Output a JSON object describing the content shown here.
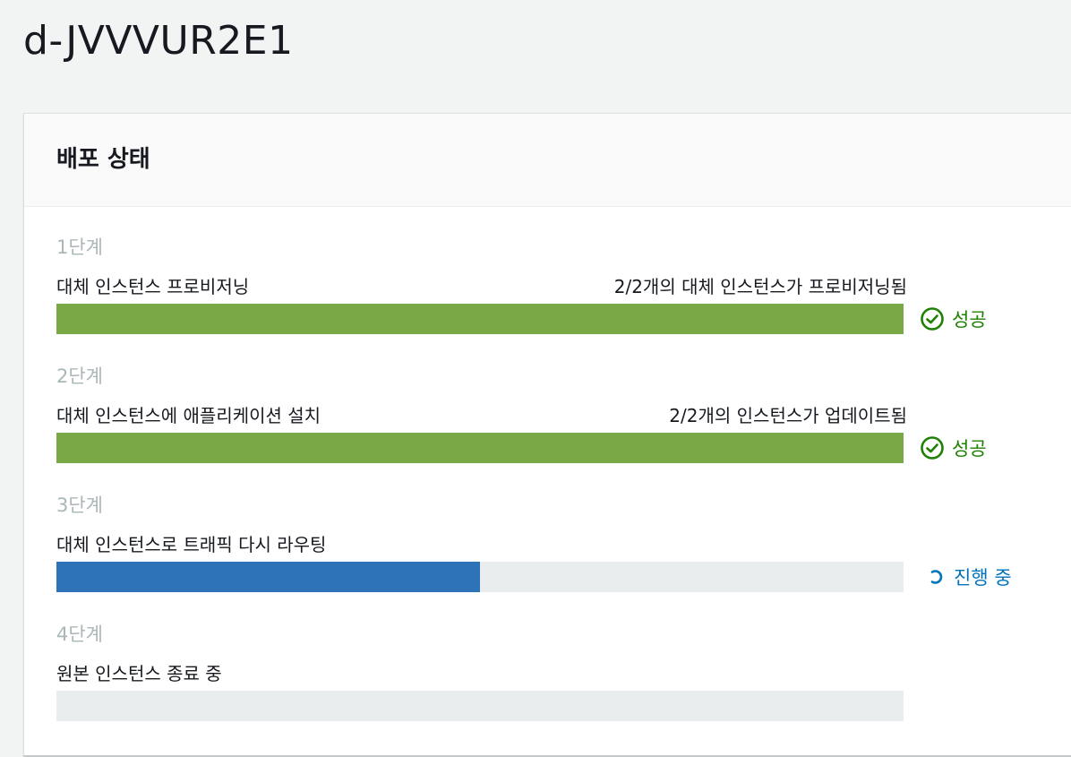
{
  "page": {
    "title": "d-JVVVUR2E1"
  },
  "panel": {
    "title": "배포 상태"
  },
  "colors": {
    "success": "#7aa847",
    "success_text": "#1d8102",
    "in_progress": "#2e73b8",
    "in_progress_text": "#0073bb",
    "track": "#eaeded"
  },
  "steps": [
    {
      "label": "1단계",
      "description": "대체 인스턴스 프로비저닝",
      "count_text": "2/2개의 대체 인스턴스가 프로비저닝됨",
      "progress": 1.0,
      "status": "성공",
      "status_icon": "check-circle-icon"
    },
    {
      "label": "2단계",
      "description": "대체 인스턴스에 애플리케이션 설치",
      "count_text": "2/2개의 인스턴스가 업데이트됨",
      "progress": 1.0,
      "status": "성공",
      "status_icon": "check-circle-icon"
    },
    {
      "label": "3단계",
      "description": "대체 인스턴스로 트래픽 다시 라우팅",
      "count_text": "",
      "progress": 0.5,
      "status": "진행 중",
      "status_icon": "spinner-icon"
    },
    {
      "label": "4단계",
      "description": "원본 인스턴스 종료 중",
      "count_text": "",
      "progress": 0.0,
      "status": "",
      "status_icon": ""
    }
  ]
}
